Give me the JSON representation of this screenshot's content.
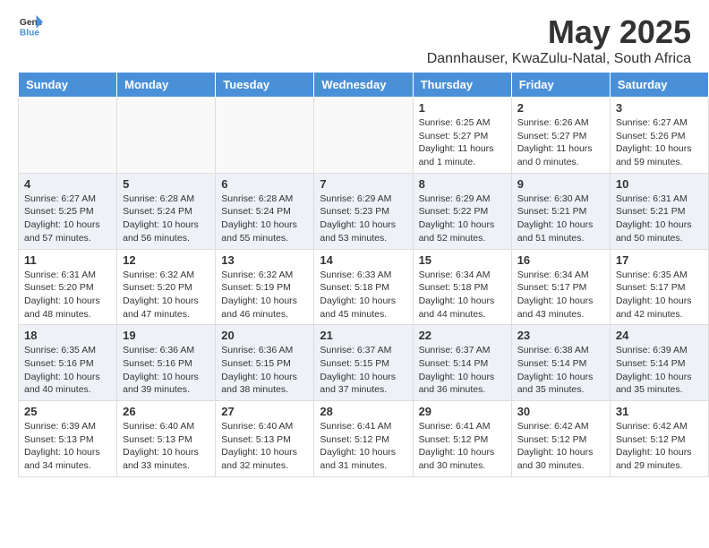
{
  "header": {
    "logo_general": "General",
    "logo_blue": "Blue",
    "month": "May 2025",
    "location": "Dannhauser, KwaZulu-Natal, South Africa"
  },
  "weekdays": [
    "Sunday",
    "Monday",
    "Tuesday",
    "Wednesday",
    "Thursday",
    "Friday",
    "Saturday"
  ],
  "rows": [
    [
      {
        "day": "",
        "info": ""
      },
      {
        "day": "",
        "info": ""
      },
      {
        "day": "",
        "info": ""
      },
      {
        "day": "",
        "info": ""
      },
      {
        "day": "1",
        "info": "Sunrise: 6:25 AM\nSunset: 5:27 PM\nDaylight: 11 hours\nand 1 minute."
      },
      {
        "day": "2",
        "info": "Sunrise: 6:26 AM\nSunset: 5:27 PM\nDaylight: 11 hours\nand 0 minutes."
      },
      {
        "day": "3",
        "info": "Sunrise: 6:27 AM\nSunset: 5:26 PM\nDaylight: 10 hours\nand 59 minutes."
      }
    ],
    [
      {
        "day": "4",
        "info": "Sunrise: 6:27 AM\nSunset: 5:25 PM\nDaylight: 10 hours\nand 57 minutes."
      },
      {
        "day": "5",
        "info": "Sunrise: 6:28 AM\nSunset: 5:24 PM\nDaylight: 10 hours\nand 56 minutes."
      },
      {
        "day": "6",
        "info": "Sunrise: 6:28 AM\nSunset: 5:24 PM\nDaylight: 10 hours\nand 55 minutes."
      },
      {
        "day": "7",
        "info": "Sunrise: 6:29 AM\nSunset: 5:23 PM\nDaylight: 10 hours\nand 53 minutes."
      },
      {
        "day": "8",
        "info": "Sunrise: 6:29 AM\nSunset: 5:22 PM\nDaylight: 10 hours\nand 52 minutes."
      },
      {
        "day": "9",
        "info": "Sunrise: 6:30 AM\nSunset: 5:21 PM\nDaylight: 10 hours\nand 51 minutes."
      },
      {
        "day": "10",
        "info": "Sunrise: 6:31 AM\nSunset: 5:21 PM\nDaylight: 10 hours\nand 50 minutes."
      }
    ],
    [
      {
        "day": "11",
        "info": "Sunrise: 6:31 AM\nSunset: 5:20 PM\nDaylight: 10 hours\nand 48 minutes."
      },
      {
        "day": "12",
        "info": "Sunrise: 6:32 AM\nSunset: 5:20 PM\nDaylight: 10 hours\nand 47 minutes."
      },
      {
        "day": "13",
        "info": "Sunrise: 6:32 AM\nSunset: 5:19 PM\nDaylight: 10 hours\nand 46 minutes."
      },
      {
        "day": "14",
        "info": "Sunrise: 6:33 AM\nSunset: 5:18 PM\nDaylight: 10 hours\nand 45 minutes."
      },
      {
        "day": "15",
        "info": "Sunrise: 6:34 AM\nSunset: 5:18 PM\nDaylight: 10 hours\nand 44 minutes."
      },
      {
        "day": "16",
        "info": "Sunrise: 6:34 AM\nSunset: 5:17 PM\nDaylight: 10 hours\nand 43 minutes."
      },
      {
        "day": "17",
        "info": "Sunrise: 6:35 AM\nSunset: 5:17 PM\nDaylight: 10 hours\nand 42 minutes."
      }
    ],
    [
      {
        "day": "18",
        "info": "Sunrise: 6:35 AM\nSunset: 5:16 PM\nDaylight: 10 hours\nand 40 minutes."
      },
      {
        "day": "19",
        "info": "Sunrise: 6:36 AM\nSunset: 5:16 PM\nDaylight: 10 hours\nand 39 minutes."
      },
      {
        "day": "20",
        "info": "Sunrise: 6:36 AM\nSunset: 5:15 PM\nDaylight: 10 hours\nand 38 minutes."
      },
      {
        "day": "21",
        "info": "Sunrise: 6:37 AM\nSunset: 5:15 PM\nDaylight: 10 hours\nand 37 minutes."
      },
      {
        "day": "22",
        "info": "Sunrise: 6:37 AM\nSunset: 5:14 PM\nDaylight: 10 hours\nand 36 minutes."
      },
      {
        "day": "23",
        "info": "Sunrise: 6:38 AM\nSunset: 5:14 PM\nDaylight: 10 hours\nand 35 minutes."
      },
      {
        "day": "24",
        "info": "Sunrise: 6:39 AM\nSunset: 5:14 PM\nDaylight: 10 hours\nand 35 minutes."
      }
    ],
    [
      {
        "day": "25",
        "info": "Sunrise: 6:39 AM\nSunset: 5:13 PM\nDaylight: 10 hours\nand 34 minutes."
      },
      {
        "day": "26",
        "info": "Sunrise: 6:40 AM\nSunset: 5:13 PM\nDaylight: 10 hours\nand 33 minutes."
      },
      {
        "day": "27",
        "info": "Sunrise: 6:40 AM\nSunset: 5:13 PM\nDaylight: 10 hours\nand 32 minutes."
      },
      {
        "day": "28",
        "info": "Sunrise: 6:41 AM\nSunset: 5:12 PM\nDaylight: 10 hours\nand 31 minutes."
      },
      {
        "day": "29",
        "info": "Sunrise: 6:41 AM\nSunset: 5:12 PM\nDaylight: 10 hours\nand 30 minutes."
      },
      {
        "day": "30",
        "info": "Sunrise: 6:42 AM\nSunset: 5:12 PM\nDaylight: 10 hours\nand 30 minutes."
      },
      {
        "day": "31",
        "info": "Sunrise: 6:42 AM\nSunset: 5:12 PM\nDaylight: 10 hours\nand 29 minutes."
      }
    ]
  ]
}
